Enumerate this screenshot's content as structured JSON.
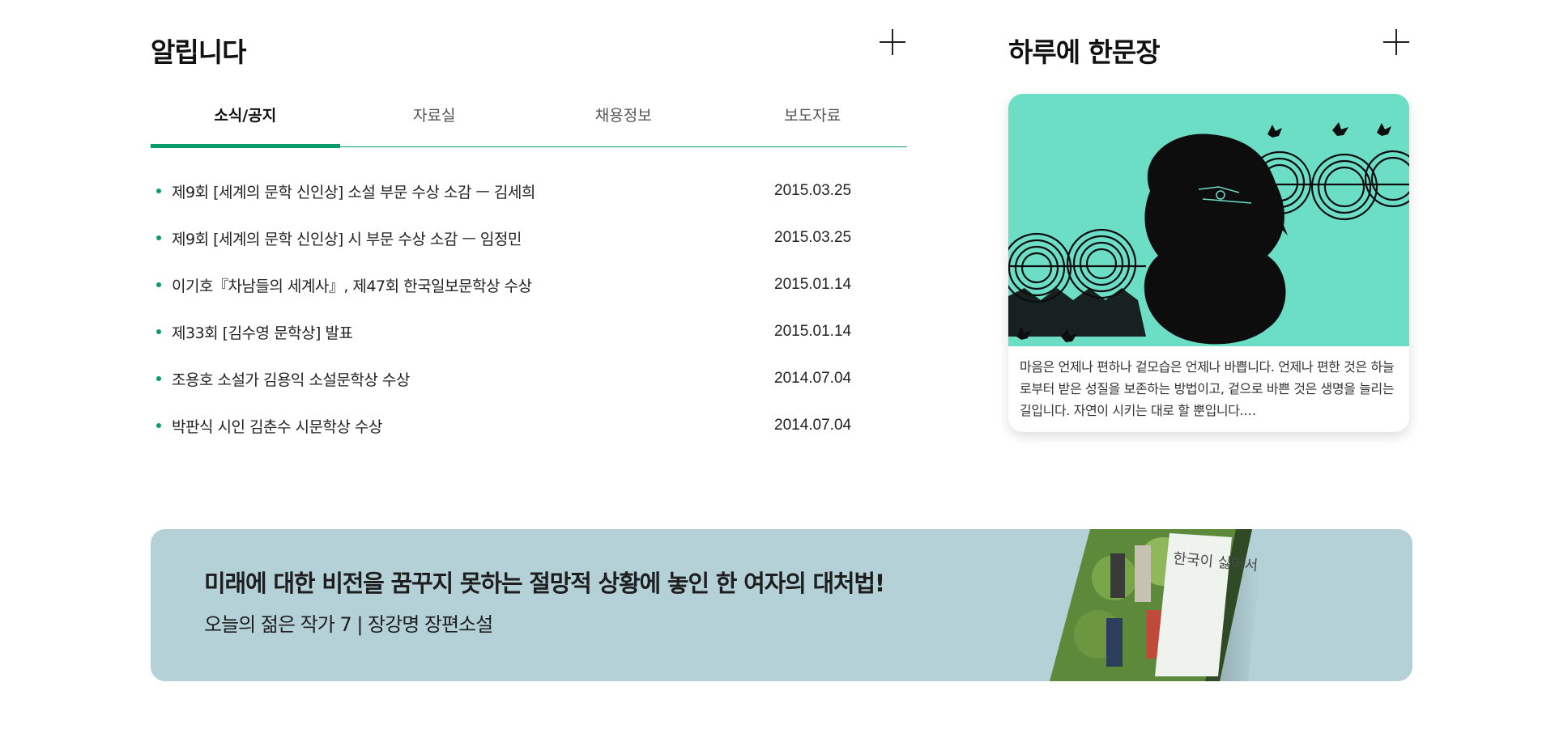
{
  "notice": {
    "title": "알립니다",
    "tabs": [
      {
        "label": "소식/공지",
        "active": true
      },
      {
        "label": "자료실",
        "active": false
      },
      {
        "label": "채용정보",
        "active": false
      },
      {
        "label": "보도자료",
        "active": false
      }
    ],
    "items": [
      {
        "title": "제9회 [세계의 문학 신인상] 소설 부문 수상 소감 ㅡ 김세희",
        "date": "2015.03.25"
      },
      {
        "title": "제9회 [세계의 문학 신인상] 시 부문 수상 소감 ㅡ 임정민",
        "date": "2015.03.25"
      },
      {
        "title": "이기호『차남들의 세계사』, 제47회 한국일보문학상 수상",
        "date": "2015.01.14"
      },
      {
        "title": "제33회 [김수영 문학상] 발표",
        "date": "2015.01.14"
      },
      {
        "title": "조용호 소설가 김용익 소설문학상 수상",
        "date": "2014.07.04"
      },
      {
        "title": "박판식 시인 김춘수 시문학상 수상",
        "date": "2014.07.04"
      }
    ]
  },
  "daily": {
    "title": "하루에 한문장",
    "text": "마음은 언제나 편하나 겉모습은 언제나 바쁩니다. 언제나 편한 것은 하늘로부터 받은 성질을 보존하는 방법이고, 겉으로 바쁜 것은 생명을 늘리는 길입니다. 자연이 시키는 대로 할 뿐입니다.…"
  },
  "banner": {
    "headline": "미래에 대한 비전을 꿈꾸지 못하는 절망적 상황에 놓인 한 여자의 대처법!",
    "subtitle": "오늘의 젊은 작가 7 | 장강명 장편소설",
    "book_title": "한국이 싫어서"
  },
  "colors": {
    "accent": "#0a9b6b",
    "card_bg": "#6ddec6",
    "banner_bg": "#b3d1d7"
  }
}
